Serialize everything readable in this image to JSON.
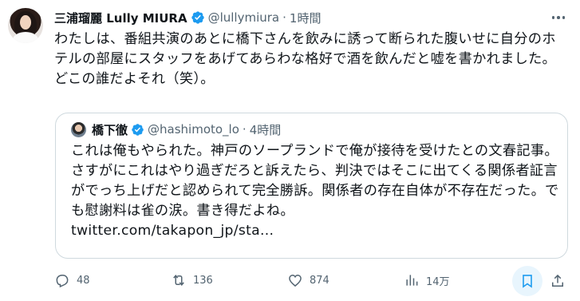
{
  "tweet": {
    "author": {
      "display_name": "三浦瑠麗 Lully MIURA",
      "handle": "@lullymiura",
      "time": "1時間",
      "verified_icon": "verified-badge-icon"
    },
    "separator": "·",
    "text": "わたしは、番組共演のあとに橋下さんを飲みに誘って断られた腹いせに自分のホテルの部屋にスタッフをあげてあらわな格好で酒を飲んだと嘘を書かれました。どこの誰だよそれ（笑）。",
    "quote": {
      "display_name": "橋下徹",
      "handle": "@hashimoto_lo",
      "time": "4時間",
      "text": "これは俺もやられた。神戸のソープランドで俺が接待を受けたとの文春記事。さすがにこれはやり過ぎだろと訴えたら、判決ではそこに出てくる関係者証言がでっち上げだと認められて完全勝訴。関係者の存在自体が不存在だった。でも慰謝料は雀の涙。書き得だよね。",
      "link": "twitter.com/takapon_jp/sta..."
    },
    "actions": {
      "replies": "48",
      "retweets": "136",
      "likes": "874",
      "views": "14万"
    },
    "colors": {
      "accent": "#1d9bf0",
      "secondary_text": "#536471",
      "border": "#cfd9de"
    }
  }
}
